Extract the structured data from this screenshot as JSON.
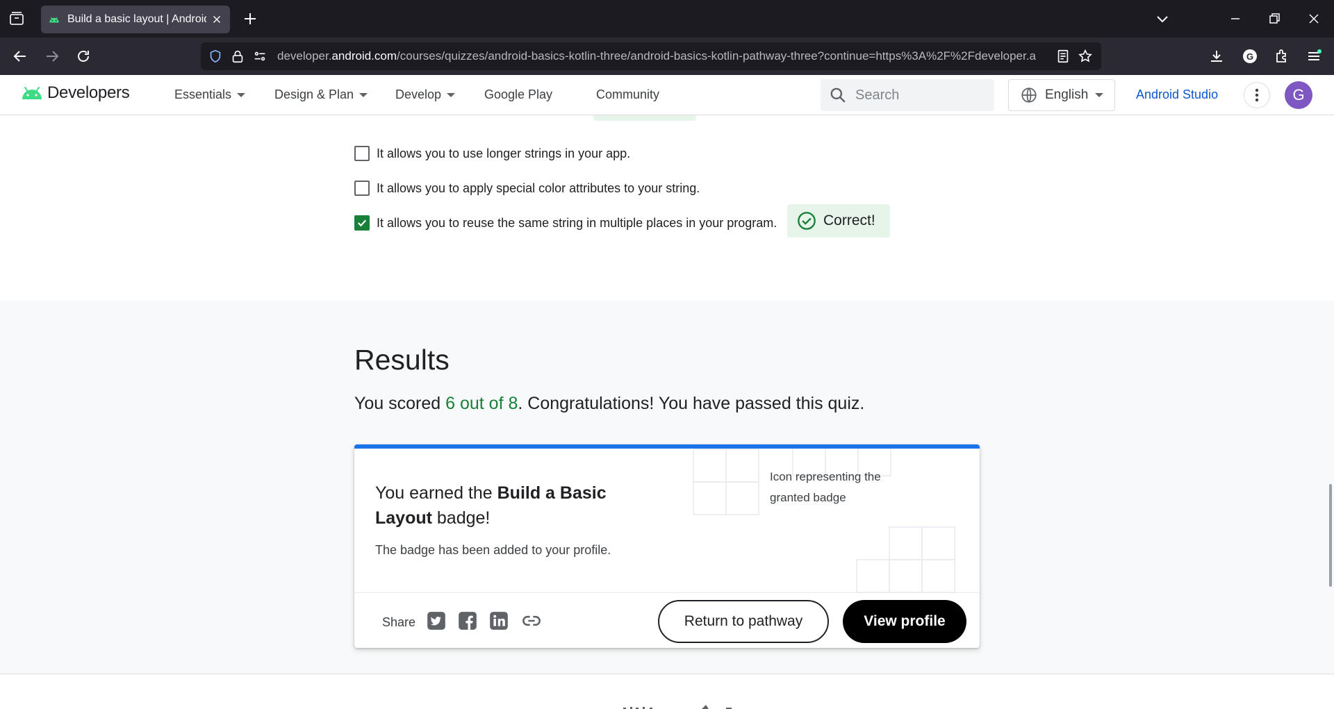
{
  "browser": {
    "tab_title": "Build a basic layout  |  Android",
    "url_domain_prefix": "developer.",
    "url_domain": "android.com",
    "url_path": "/courses/quizzes/android-basics-kotlin-three/android-basics-kotlin-pathway-three?continue=https%3A%2F%2Fdeveloper.a"
  },
  "header": {
    "brand": "Developers",
    "menu": [
      {
        "label": "Essentials"
      },
      {
        "label": "Design & Plan"
      },
      {
        "label": "Develop"
      },
      {
        "label": "Google Play"
      },
      {
        "label": "Community"
      }
    ],
    "search_placeholder": "Search",
    "language": "English",
    "studio_link": "Android Studio",
    "avatar_initial": "G"
  },
  "quiz": {
    "options": [
      {
        "text": "It allows you to use longer strings in your app.",
        "checked": false
      },
      {
        "text": "It allows you to apply special color attributes to your string.",
        "checked": false
      },
      {
        "text": "It allows you to reuse the same string in multiple places in your program.",
        "checked": true
      }
    ],
    "feedback": "Correct!"
  },
  "results": {
    "title": "Results",
    "score_prefix": "You scored ",
    "score": "6 out of 8",
    "score_suffix": ". Congratulations! You have passed this quiz.",
    "badge_prefix": "You earned the ",
    "badge_name": "Build a Basic Layout",
    "badge_suffix": " badge!",
    "badge_subtitle": "The badge has been added to your profile.",
    "badge_icon_alt": "Icon representing the granted badge",
    "share_label": "Share",
    "share_icons": [
      "twitter-icon",
      "facebook-icon",
      "linkedin-icon",
      "link-icon"
    ],
    "return_button": "Return to pathway",
    "profile_button": "View profile"
  },
  "colors": {
    "accent_blue": "#1a73e8",
    "success_green": "#188038",
    "avatar_purple": "#7e57c2"
  }
}
